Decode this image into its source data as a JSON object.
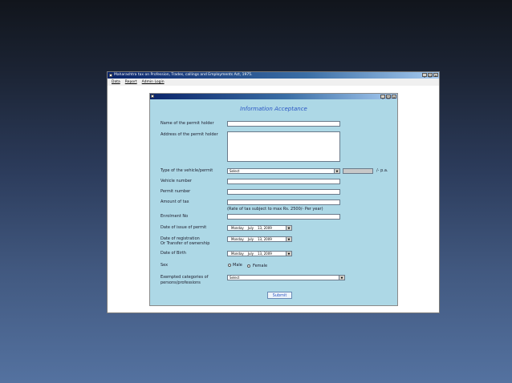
{
  "app": {
    "title": "Maharashtra tax on Profession, Trades, callings and Employments Act, 1975.",
    "menu": [
      "Data",
      "Report",
      "Admin Login"
    ]
  },
  "form": {
    "heading": "Information Acceptance",
    "labels": {
      "name": "Name of the permit holder",
      "address": "Address of the permit holder",
      "vehicle_type": "Type of the vehicle/permit",
      "vehicle_number": "Vehicle number",
      "permit_number": "Permit number",
      "amount_of_tax": "Amount of tax",
      "enrolment_no": "Enrolment No",
      "date_of_issue": "Date of issue of permit",
      "date_of_registration_1": "Date of registration",
      "date_of_registration_2": "Or Transfer of ownership",
      "date_of_birth": "Date of Birth",
      "sex": "Sex",
      "exempted_1": "Exempted categories of",
      "exempted_2": "persons/professions"
    },
    "vehicle_type_select": "Select",
    "per_annum": "/- p.a.",
    "tax_note": "(Rate of tax subject to max Rs. 2500/- Per year)",
    "dates": {
      "issue": {
        "day": "Monday",
        "month": "July",
        "date": "13, 2009"
      },
      "registration": {
        "day": "Monday",
        "month": "July",
        "date": "13, 2009"
      },
      "birth": {
        "day": "Monday",
        "month": "July",
        "date": "13, 2009"
      }
    },
    "sex_options": {
      "male": "Male",
      "female": "Female"
    },
    "exempted_select": "Select",
    "submit_label": "Submit"
  }
}
